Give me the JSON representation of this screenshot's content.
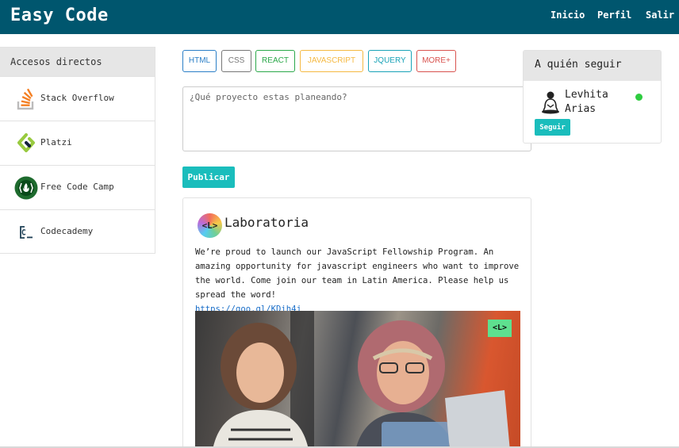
{
  "header": {
    "brand": "Easy Code",
    "nav": [
      {
        "label": "Inicio"
      },
      {
        "label": "Perfil"
      },
      {
        "label": "Salir"
      }
    ],
    "background": "#00566e"
  },
  "sidebar": {
    "title": "Accesos directos",
    "items": [
      {
        "label": "Stack Overflow",
        "icon": "stackoverflow-icon"
      },
      {
        "label": "Platzi",
        "icon": "platzi-icon"
      },
      {
        "label": "Free Code Camp",
        "icon": "freecodecamp-icon"
      },
      {
        "label": "Codecademy",
        "icon": "codecademy-icon"
      }
    ]
  },
  "tags": [
    {
      "label": "HTML",
      "color": "#2b7fc7"
    },
    {
      "label": "CSS",
      "color": "#777777"
    },
    {
      "label": "REACT",
      "color": "#2ba84a"
    },
    {
      "label": "JAVASCRIPT",
      "color": "#f5b942"
    },
    {
      "label": "JQUERY",
      "color": "#1aa3b8"
    },
    {
      "label": "MORE+",
      "color": "#d9534f"
    }
  ],
  "composer": {
    "placeholder": "¿Qué proyecto estas planeando?",
    "value": "",
    "publish_label": "Publicar",
    "accent": "#1abdbc"
  },
  "post": {
    "logo_text": "<L>",
    "author": "Laboratoria",
    "text": "We’re proud to launch our JavaScript Fellowship Program. An amazing opportunity for javascript engineers who want to improve the world. Come join our team in Latin America. Please help us spread the word!",
    "link": "https://goo.gl/KDih4j",
    "image_badge": "<L>"
  },
  "follow": {
    "title": "A quién seguir",
    "user": {
      "name": "Levhita Arias",
      "status": "online",
      "status_color": "#2ecc40"
    },
    "button_label": "Seguir"
  }
}
